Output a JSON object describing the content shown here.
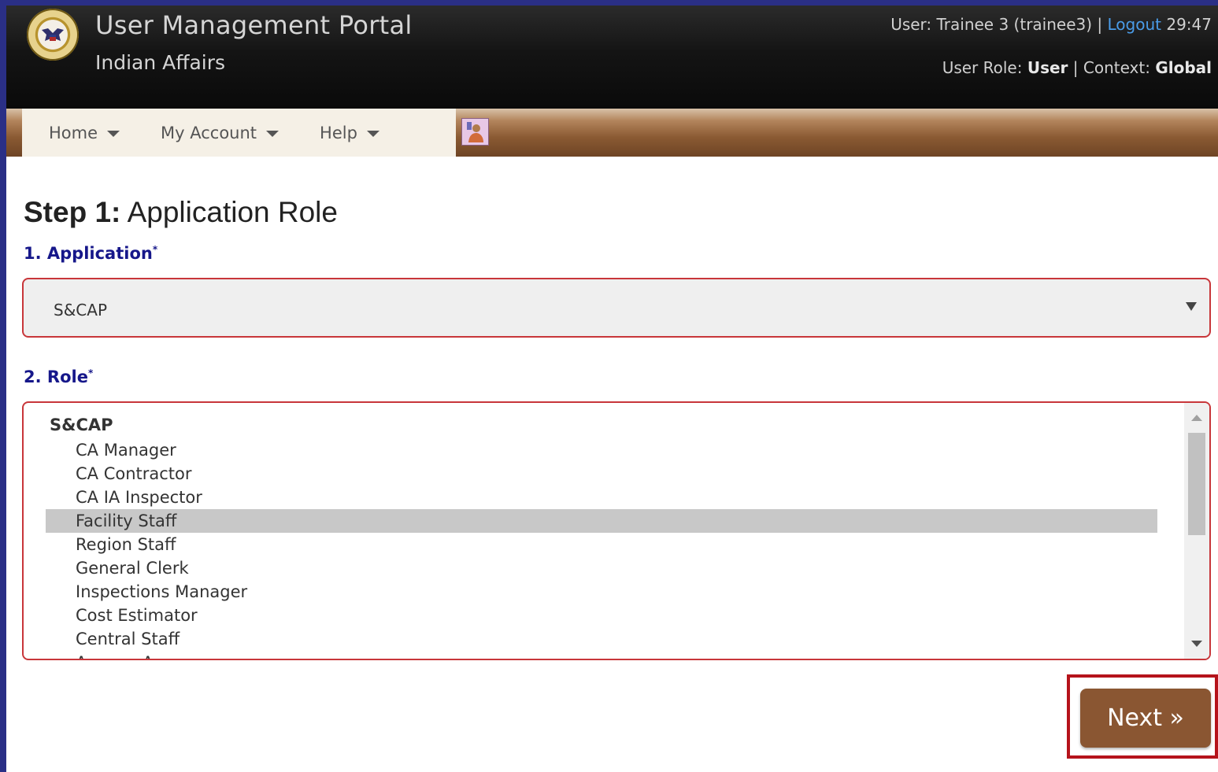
{
  "header": {
    "app_title": "User Management Portal",
    "app_subtitle": "Indian Affairs",
    "user_prefix": "User: Trainee 3 (trainee3) |",
    "logout_label": "Logout",
    "session_timer": "29:47",
    "role_label": "User Role:",
    "role_value": "User",
    "context_label": "| Context:",
    "context_value": "Global"
  },
  "nav": {
    "items": [
      {
        "label": "Home"
      },
      {
        "label": "My Account"
      },
      {
        "label": "Help"
      }
    ],
    "icon": "user-badge-icon"
  },
  "main": {
    "step_bold": "Step 1:",
    "step_title": " Application Role",
    "application_label": "1. Application",
    "application_value": "S&CAP",
    "role_label": "2. Role",
    "required_marker": "*",
    "role_group": "S&CAP",
    "role_options": [
      "CA Manager",
      "CA Contractor",
      "CA IA Inspector",
      "Facility Staff",
      "Region Staff",
      "General Clerk",
      "Inspections Manager",
      "Cost Estimator",
      "Central Staff",
      "Agency Approver"
    ],
    "selected_role": "Facility Staff",
    "next_label": "Next »"
  },
  "colors": {
    "accent_red": "#c8363a",
    "label_blue": "#16178a",
    "button_brown": "#8a5632",
    "logout_blue": "#4a9ce8"
  }
}
